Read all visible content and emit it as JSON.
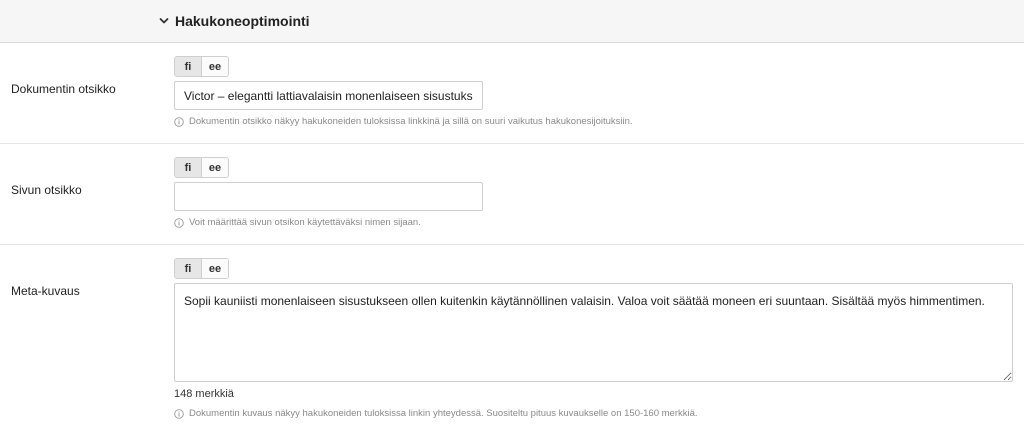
{
  "section": {
    "title": "Hakukoneoptimointi",
    "toggle_icon": "chevron-down-icon"
  },
  "languages": [
    "fi",
    "ee"
  ],
  "active_language": "fi",
  "fields": {
    "doc_title": {
      "label": "Dokumentin otsikko",
      "value": "Victor – elegantti lattiavalaisin monenlaiseen sisustukseen",
      "hint": "Dokumentin otsikko näkyy hakukoneiden tuloksissa linkkinä ja sillä on suuri vaikutus hakukonesijoituksiin."
    },
    "page_title": {
      "label": "Sivun otsikko",
      "value": "",
      "hint": "Voit määrittää sivun otsikon käytettäväksi nimen sijaan."
    },
    "meta_description": {
      "label": "Meta-kuvaus",
      "value": "Sopii kauniisti monenlaiseen sisustukseen ollen kuitenkin käytännöllinen valaisin. Valoa voit säätää moneen eri suuntaan. Sisältää myös himmentimen.",
      "char_count": "148 merkkiä",
      "hint": "Dokumentin kuvaus näkyy hakukoneiden tuloksissa linkin yhteydessä. Suositeltu pituus kuvaukselle on 150-160 merkkiä."
    }
  },
  "colors": {
    "header_bg": "#f6f6f6",
    "border": "#cfcfcf",
    "hint_text": "#8a8a8a",
    "active_lang_bg": "#e6e6e6"
  }
}
